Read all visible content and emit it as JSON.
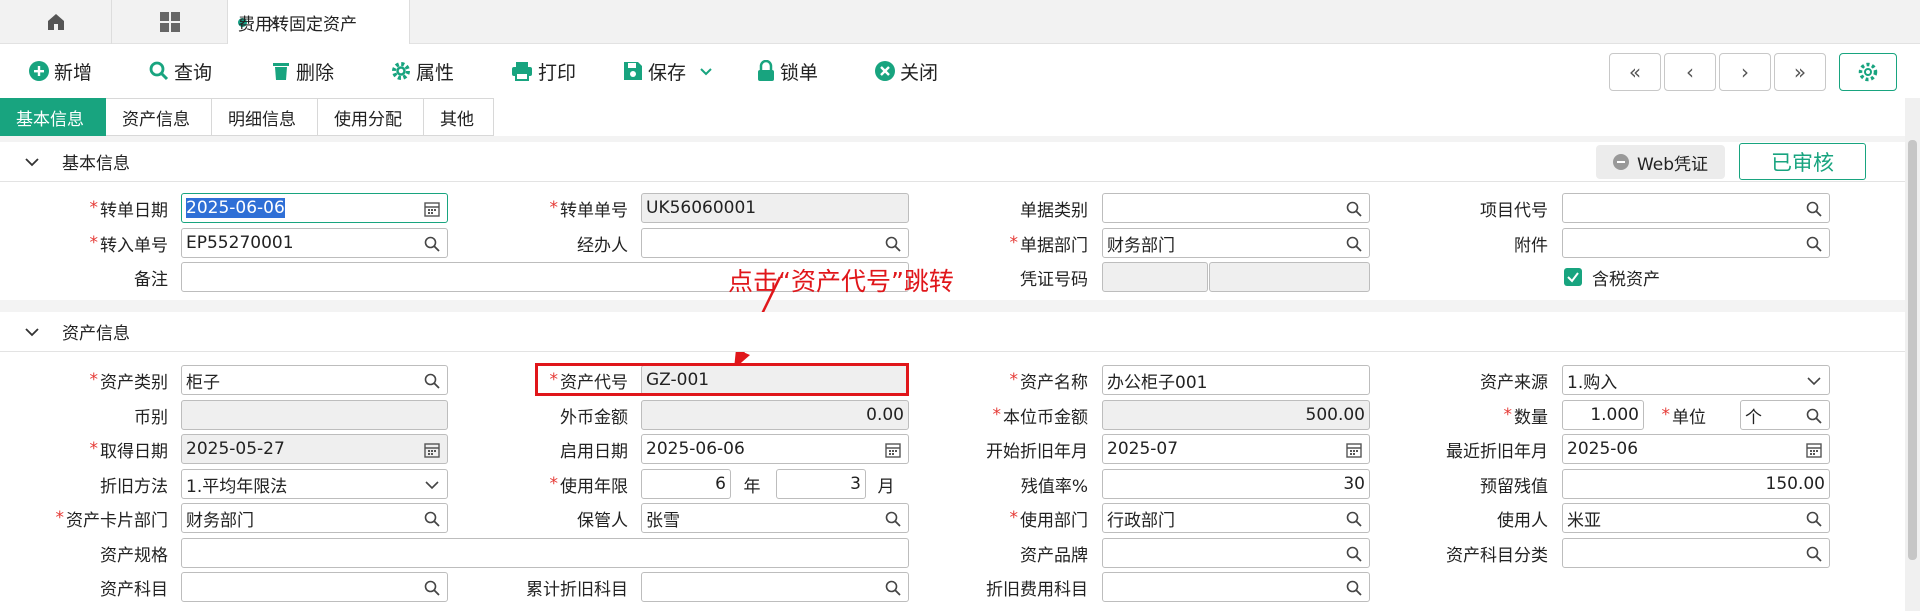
{
  "tabs": {
    "doc_label": "费用转固定资产",
    "close": "×"
  },
  "toolbar": {
    "new": "新增",
    "query": "查询",
    "delete": "删除",
    "props": "属性",
    "print": "打印",
    "save": "保存",
    "lock": "锁单",
    "close": "关闭"
  },
  "nav": {
    "first": "«",
    "prev": "‹",
    "next": "›",
    "last": "»"
  },
  "subtabs": [
    "基本信息",
    "资产信息",
    "明细信息",
    "使用分配",
    "其他"
  ],
  "section_basic": "基本信息",
  "section_asset": "资产信息",
  "web_voucher": "Web凭证",
  "audited": "已审核",
  "basic": {
    "transfer_date_label": "转单日期",
    "transfer_date": "2025-06-06",
    "transfer_no_label": "转单单号",
    "transfer_no": "UK56060001",
    "doc_type_label": "单据类别",
    "doc_type": "",
    "project_label": "项目代号",
    "project": "",
    "in_no_label": "转入单号",
    "in_no": "EP55270001",
    "handler_label": "经办人",
    "handler": "",
    "dept_label": "单据部门",
    "dept": "财务部门",
    "attach_label": "附件",
    "attach": "",
    "remark_label": "备注",
    "remark": "",
    "voucher_label": "凭证号码",
    "tax_asset_label": "含税资产"
  },
  "annotation": "点击“资产代号”跳转",
  "asset": {
    "category_label": "资产类别",
    "category": "柜子",
    "code_label": "资产代号",
    "code": "GZ-001",
    "name_label": "资产名称",
    "name": "办公柜子001",
    "source_label": "资产来源",
    "source": "1.购入",
    "currency_label": "币别",
    "currency": "",
    "fx_amount_label": "外币金额",
    "fx_amount": "0.00",
    "local_amount_label": "本位币金额",
    "local_amount": "500.00",
    "qty_label": "数量",
    "qty": "1.000",
    "unit_label": "单位",
    "unit": "个",
    "acq_date_label": "取得日期",
    "acq_date": "2025-05-27",
    "start_date_label": "启用日期",
    "start_date": "2025-06-06",
    "dep_start_label": "开始折旧年月",
    "dep_start": "2025-07",
    "last_dep_label": "最近折旧年月",
    "last_dep": "2025-06",
    "dep_method_label": "折旧方法",
    "dep_method": "1.平均年限法",
    "life_label": "使用年限",
    "life_years": "6",
    "year_unit": "年",
    "life_months": "3",
    "month_unit": "月",
    "residual_rate_label": "残值率%",
    "residual_rate": "30",
    "residual_label": "预留残值",
    "residual": "150.00",
    "card_dept_label": "资产卡片部门",
    "card_dept": "财务部门",
    "keeper_label": "保管人",
    "keeper": "张雪",
    "use_dept_label": "使用部门",
    "use_dept": "行政部门",
    "user_label": "使用人",
    "user": "米亚",
    "spec_label": "资产规格",
    "spec": "",
    "brand_label": "资产品牌",
    "brand": "",
    "subject_class_label": "资产科目分类",
    "subject_class": "",
    "subject_label": "资产科目",
    "subject": "",
    "acc_dep_label": "累计折旧科目",
    "acc_dep": "",
    "dep_exp_label": "折旧费用科目",
    "dep_exp": ""
  },
  "colors": {
    "accent": "#18a47f",
    "required": "#e53935",
    "annotation": "#e0161a"
  }
}
